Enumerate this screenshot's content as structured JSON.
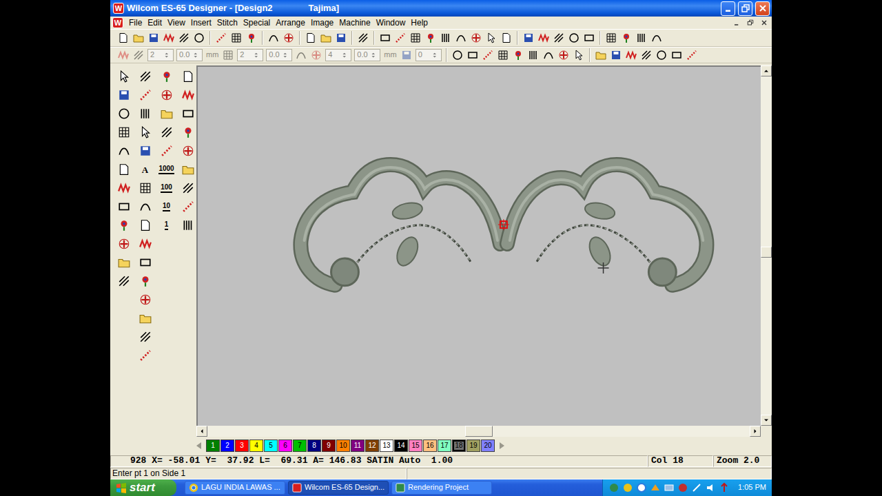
{
  "window": {
    "logo": "W",
    "title": "Wilcom ES-65 Designer - [Design2",
    "machine": "Tajima]"
  },
  "menu": [
    "File",
    "Edit",
    "View",
    "Insert",
    "Stitch",
    "Special",
    "Arrange",
    "Image",
    "Machine",
    "Window",
    "Help"
  ],
  "toolbar_main": [
    {
      "kind": "button"
    },
    {
      "kind": "button"
    },
    {
      "kind": "button"
    },
    {
      "kind": "button"
    },
    {
      "kind": "button"
    },
    {
      "kind": "button"
    },
    {
      "kind": "separator"
    },
    {
      "kind": "button"
    },
    {
      "kind": "button"
    },
    {
      "kind": "button"
    },
    {
      "kind": "separator"
    },
    {
      "kind": "button"
    },
    {
      "kind": "button"
    },
    {
      "kind": "separator"
    },
    {
      "kind": "button"
    },
    {
      "kind": "button"
    },
    {
      "kind": "button"
    },
    {
      "kind": "separator"
    },
    {
      "kind": "button"
    },
    {
      "kind": "separator"
    },
    {
      "kind": "button"
    },
    {
      "kind": "button"
    },
    {
      "kind": "button"
    },
    {
      "kind": "button"
    },
    {
      "kind": "button"
    },
    {
      "kind": "button"
    },
    {
      "kind": "button"
    },
    {
      "kind": "button"
    },
    {
      "kind": "button"
    },
    {
      "kind": "separator"
    },
    {
      "kind": "button"
    },
    {
      "kind": "button"
    },
    {
      "kind": "button"
    },
    {
      "kind": "button"
    },
    {
      "kind": "button"
    },
    {
      "kind": "separator"
    },
    {
      "kind": "button"
    },
    {
      "kind": "button"
    },
    {
      "kind": "button"
    },
    {
      "kind": "button"
    }
  ],
  "toolbar_values": [
    {
      "kind": "button",
      "disabled": true
    },
    {
      "kind": "button",
      "disabled": true
    },
    {
      "kind": "spin",
      "value": "2",
      "disabled": true
    },
    {
      "kind": "spin",
      "value": "0.0",
      "disabled": true
    },
    {
      "kind": "unit",
      "label": "mm",
      "disabled": true
    },
    {
      "kind": "button",
      "disabled": true
    },
    {
      "kind": "spin",
      "value": "2",
      "disabled": true
    },
    {
      "kind": "spin",
      "value": "0.0",
      "disabled": true
    },
    {
      "kind": "button",
      "disabled": true
    },
    {
      "kind": "button",
      "disabled": true
    },
    {
      "kind": "spin",
      "value": "4",
      "disabled": true
    },
    {
      "kind": "spin",
      "value": "0.0",
      "disabled": true
    },
    {
      "kind": "unit",
      "label": "mm",
      "disabled": true
    },
    {
      "kind": "button",
      "disabled": true
    },
    {
      "kind": "spin",
      "value": "0",
      "disabled": true
    },
    {
      "kind": "separator"
    },
    {
      "kind": "button",
      "disabled": false
    },
    {
      "kind": "button",
      "disabled": false
    },
    {
      "kind": "button",
      "disabled": false
    },
    {
      "kind": "button",
      "disabled": false
    },
    {
      "kind": "button",
      "disabled": false
    },
    {
      "kind": "button",
      "disabled": false
    },
    {
      "kind": "button",
      "disabled": false
    },
    {
      "kind": "button",
      "disabled": false
    },
    {
      "kind": "button",
      "disabled": false
    },
    {
      "kind": "separator"
    },
    {
      "kind": "button",
      "disabled": false
    },
    {
      "kind": "button",
      "disabled": false
    },
    {
      "kind": "button",
      "disabled": false
    },
    {
      "kind": "button",
      "disabled": false
    },
    {
      "kind": "button",
      "disabled": false
    },
    {
      "kind": "button",
      "disabled": false
    },
    {
      "kind": "button",
      "disabled": false
    }
  ],
  "toolbox": [
    [
      {
        "kind": "icon"
      },
      {
        "kind": "icon"
      },
      {
        "kind": "icon"
      },
      {
        "kind": "icon"
      },
      {
        "kind": "icon"
      },
      {
        "kind": "icon"
      },
      {
        "kind": "icon"
      },
      {
        "kind": "icon"
      },
      {
        "kind": "icon"
      },
      {
        "kind": "icon"
      },
      {
        "kind": "icon"
      },
      {
        "kind": "icon"
      }
    ],
    [
      {
        "kind": "icon"
      },
      {
        "kind": "icon"
      },
      {
        "kind": "icon"
      },
      {
        "kind": "icon"
      },
      {
        "kind": "icon"
      },
      {
        "kind": "text",
        "label": "A"
      },
      {
        "kind": "icon"
      },
      {
        "kind": "icon"
      },
      {
        "kind": "icon"
      },
      {
        "kind": "icon"
      },
      {
        "kind": "icon"
      },
      {
        "kind": "icon"
      },
      {
        "kind": "icon"
      },
      {
        "kind": "icon"
      },
      {
        "kind": "icon"
      },
      {
        "kind": "icon"
      }
    ],
    [
      {
        "kind": "icon"
      },
      {
        "kind": "icon"
      },
      {
        "kind": "icon"
      },
      {
        "kind": "icon"
      },
      {
        "kind": "icon"
      },
      {
        "kind": "number",
        "label": "1000"
      },
      {
        "kind": "number",
        "label": "100"
      },
      {
        "kind": "number",
        "label": "10"
      },
      {
        "kind": "number",
        "label": "1"
      }
    ],
    [
      {
        "kind": "icon"
      },
      {
        "kind": "icon"
      },
      {
        "kind": "icon"
      },
      {
        "kind": "icon"
      },
      {
        "kind": "icon"
      },
      {
        "kind": "icon"
      },
      {
        "kind": "icon"
      },
      {
        "kind": "icon"
      },
      {
        "kind": "icon"
      }
    ]
  ],
  "canvas": {
    "scroll": {
      "vertical": 0.52,
      "horizontal": 0.5
    }
  },
  "palette": [
    {
      "label": "1",
      "color": "#008000",
      "selected": false
    },
    {
      "label": "2",
      "color": "#0000ff",
      "selected": false
    },
    {
      "label": "3",
      "color": "#ff0000",
      "selected": false
    },
    {
      "label": "4",
      "color": "#ffff00",
      "selected": false
    },
    {
      "label": "5",
      "color": "#00ffff",
      "selected": false
    },
    {
      "label": "6",
      "color": "#ff00ff",
      "selected": false
    },
    {
      "label": "7",
      "color": "#00c000",
      "selected": false
    },
    {
      "label": "8",
      "color": "#000080",
      "selected": false
    },
    {
      "label": "9",
      "color": "#800000",
      "selected": false
    },
    {
      "label": "10",
      "color": "#ff8000",
      "selected": false
    },
    {
      "label": "11",
      "color": "#800080",
      "selected": false
    },
    {
      "label": "12",
      "color": "#804000",
      "selected": false
    },
    {
      "label": "13",
      "color": "#ffffff",
      "selected": false
    },
    {
      "label": "14",
      "color": "#000000",
      "selected": false
    },
    {
      "label": "15",
      "color": "#ff80c0",
      "selected": false
    },
    {
      "label": "16",
      "color": "#ffc080",
      "selected": false
    },
    {
      "label": "17",
      "color": "#80ffc0",
      "selected": false
    },
    {
      "label": "18",
      "color": "#707070",
      "selected": true
    },
    {
      "label": "19",
      "color": "#a0a060",
      "selected": false
    },
    {
      "label": "20",
      "color": "#8080ff",
      "selected": false
    }
  ],
  "status": {
    "readout": "928 X= -58.01 Y=  37.92 L=  69.31 A= 146.83 SATIN Auto  1.00",
    "color": "Col 18",
    "zoom": "Zoom 2.0",
    "prompt": "Enter pt 1 on Side 1"
  },
  "taskbar": {
    "start": "start",
    "tasks": [
      {
        "label": "LAGU INDIA LAWAS ...",
        "selected": false
      },
      {
        "label": "Wilcom ES-65 Design...",
        "selected": true
      },
      {
        "label": "Rendering Project",
        "selected": false
      }
    ],
    "clock": "1:05 PM"
  }
}
